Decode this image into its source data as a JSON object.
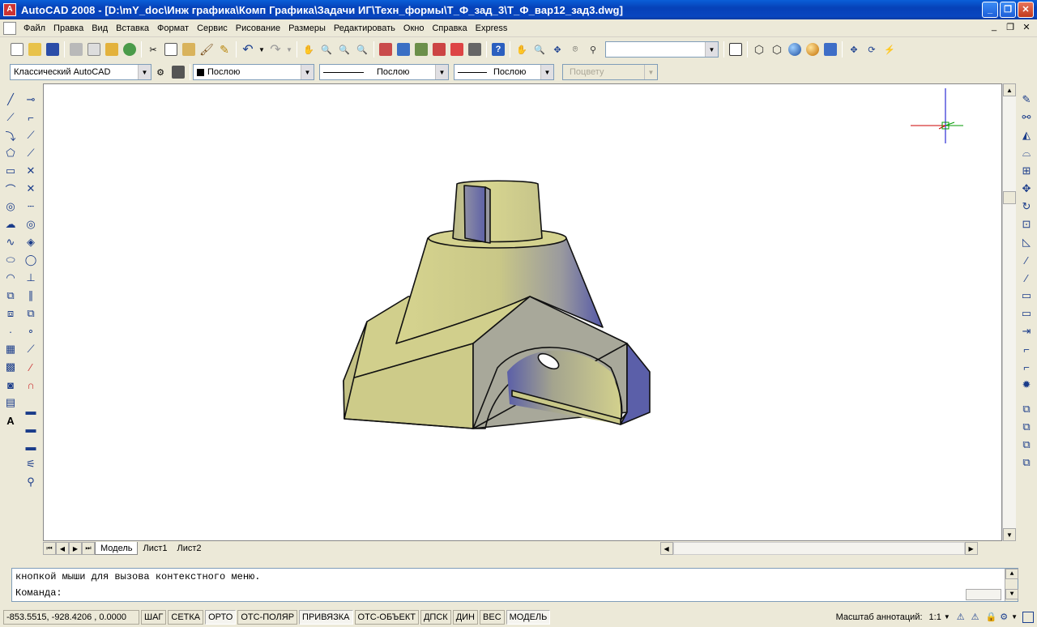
{
  "window": {
    "title": "AutoCAD 2008 - [D:\\mY_doc\\Инж графика\\Комп Графика\\Задачи ИГ\\Техн_формы\\Т_Ф_зад_3\\Т_Ф_вар12_зад3.dwg]",
    "minimize": "_",
    "maximize": "❐",
    "close": "✕"
  },
  "menu": {
    "items": [
      "Файл",
      "Правка",
      "Вид",
      "Вставка",
      "Формат",
      "Сервис",
      "Рисование",
      "Размеры",
      "Редактировать",
      "Окно",
      "Справка",
      "Express"
    ],
    "mdi_min": "_",
    "mdi_restore": "❐",
    "mdi_close": "✕"
  },
  "toolbar2": {
    "workspace": "Классический AutoCAD",
    "layer": "Послою",
    "linetype": "Послою",
    "lineweight": "Послою",
    "plotstyle": "Поцвету"
  },
  "toolbar1": {
    "style_combo": ""
  },
  "tabs": [
    "Модель",
    "Лист1",
    "Лист2"
  ],
  "command": {
    "history": "кнопкой мыши для вызова контекстного меню.",
    "prompt": "Команда:"
  },
  "status": {
    "coords": "-853.5515, -928.4206 , 0.0000",
    "toggles": [
      {
        "label": "ШАГ",
        "on": false
      },
      {
        "label": "СЕТКА",
        "on": false
      },
      {
        "label": "ОРТО",
        "on": true
      },
      {
        "label": "ОТС-ПОЛЯР",
        "on": false
      },
      {
        "label": "ПРИВЯЗКА",
        "on": true
      },
      {
        "label": "ОТС-ОБЪЕКТ",
        "on": false
      },
      {
        "label": "ДПСК",
        "on": false
      },
      {
        "label": "ДИН",
        "on": false
      },
      {
        "label": "ВЕС",
        "on": false
      },
      {
        "label": "МОДЕЛЬ",
        "on": true
      }
    ],
    "annotation_scale_label": "Масштаб аннотаций:",
    "annotation_scale": "1:1"
  },
  "colors": {
    "model_face_light": "#d2d18f",
    "model_face_shadow": "#5a5fa6",
    "model_face_grey": "#a9a99b",
    "ucs_red": "#cc0000",
    "ucs_green": "#009900",
    "ucs_blue": "#0000cc"
  }
}
